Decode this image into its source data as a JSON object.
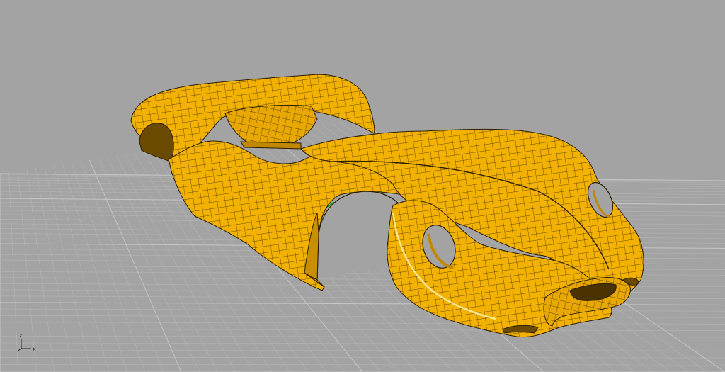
{
  "viewport": {
    "background": "#a3a3a3",
    "grid_minor_color": "#b4b4b4",
    "grid_major_color": "#c6c6c6",
    "model_color": "#f4b200",
    "model_edge_color": "#2a1e00",
    "axis_x_color": "#cc2200",
    "axis_y_color": "#00aa00"
  },
  "axes_widget": {
    "z_label": "z",
    "x_label": "x"
  }
}
